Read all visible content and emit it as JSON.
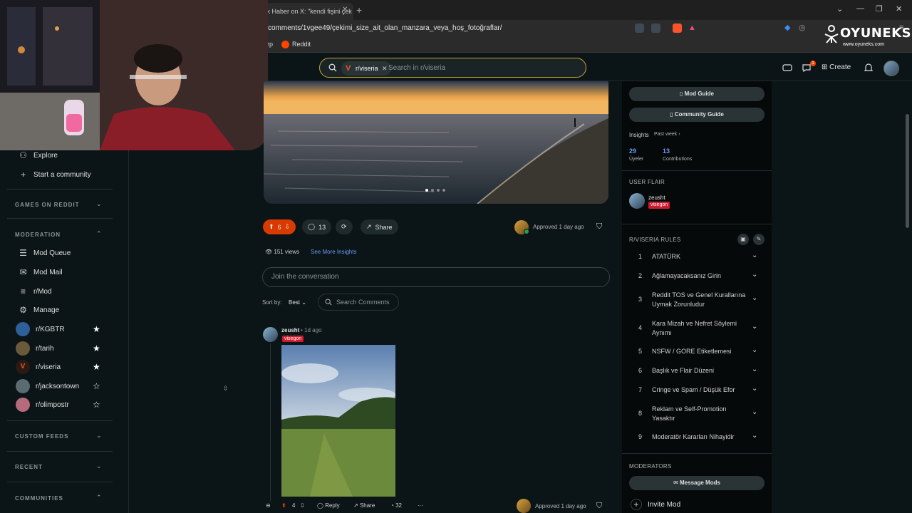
{
  "browser": {
    "tab_title": "mak Haber on X: \"kendi fişini çek",
    "url": "comments/1vgee49/çekimi_size_ait_olan_manzara_veya_hoş_fotoğraflar/",
    "bookmarks": [
      "rp",
      "Reddit"
    ]
  },
  "watermark": {
    "title": "OYUNEKS",
    "subtitle": "www.oyuneks.com"
  },
  "header": {
    "search_chip": "r/viseria",
    "search_placeholder": "Search in r/viseria",
    "create_label": "Create",
    "chat_badge": "1"
  },
  "sidebar": {
    "items": [
      {
        "label": "Explore",
        "icon": "compass-icon"
      },
      {
        "label": "Start a community",
        "icon": "plus-icon"
      }
    ],
    "games_section": "GAMES ON REDDIT",
    "moderation_section": "MODERATION",
    "mod_items": [
      {
        "label": "Mod Queue",
        "icon": "queue-icon"
      },
      {
        "label": "Mod Mail",
        "icon": "mail-icon"
      },
      {
        "label": "r/Mod",
        "icon": "list-icon"
      },
      {
        "label": "Manage",
        "icon": "gear-icon"
      }
    ],
    "communities": [
      {
        "name": "r/KGBTR",
        "starred": true
      },
      {
        "name": "r/tarih",
        "starred": true
      },
      {
        "name": "r/viseria",
        "starred": true
      },
      {
        "name": "r/jacksontown",
        "starred": false
      },
      {
        "name": "r/olimpostr",
        "starred": false
      }
    ],
    "custom_feeds_section": "CUSTOM FEEDS",
    "recent_section": "RECENT",
    "communities_section": "COMMUNITIES"
  },
  "post": {
    "score": "6",
    "comments": "13",
    "share_label": "Share",
    "approved": "Approved 1 day ago",
    "views": "151 views",
    "insights_link": "See More Insights",
    "join_placeholder": "Join the conversation",
    "sort_label": "Sort by:",
    "sort_value": "Best",
    "search_comments": "Search Comments"
  },
  "comment": {
    "user": "zeusht",
    "time": "• 1d ago",
    "flair": "visegon",
    "score": "4",
    "reply_label": "Reply",
    "share_label": "Share",
    "awards": "32",
    "approved": "Approved 1 day ago"
  },
  "right_sidebar": {
    "mod_guide": "Mod Guide",
    "community_guide": "Community Guide",
    "insights_label": "Insights",
    "insights_period": "Past week",
    "members_value": "29",
    "members_label": "Üyeler",
    "contrib_value": "13",
    "contrib_label": "Contributions",
    "user_flair_head": "USER FLAIR",
    "flair_user": "zeusht",
    "flair_tag": "visegon",
    "rules_head": "R/VISERIA RULES",
    "rules": [
      {
        "n": "1",
        "text": "ATATÜRK"
      },
      {
        "n": "2",
        "text": "Ağlamayacaksanız Girin"
      },
      {
        "n": "3",
        "text": "Reddit TOS ve Genel Kurallarına Uymak Zorunludur"
      },
      {
        "n": "4",
        "text": "Kara Mizah ve Nefret Söylemi Aynımı"
      },
      {
        "n": "5",
        "text": "NSFW / GORE Etiketlemesi"
      },
      {
        "n": "6",
        "text": "Başlık ve Flair Düzeni"
      },
      {
        "n": "7",
        "text": "Cringe ve Spam / Düşük Efor"
      },
      {
        "n": "8",
        "text": "Reklam ve Self-Promotion Yasaktır"
      },
      {
        "n": "9",
        "text": "Moderatör Kararları Nihayidir"
      }
    ],
    "moderators_head": "MODERATORS",
    "message_mods": "Message Mods",
    "invite_mod": "Invite Mod"
  },
  "colors": {
    "accent": "#ff4500",
    "flair": "#cc1b2e",
    "link": "#6b9bf5",
    "search_border": "#c8a534"
  }
}
